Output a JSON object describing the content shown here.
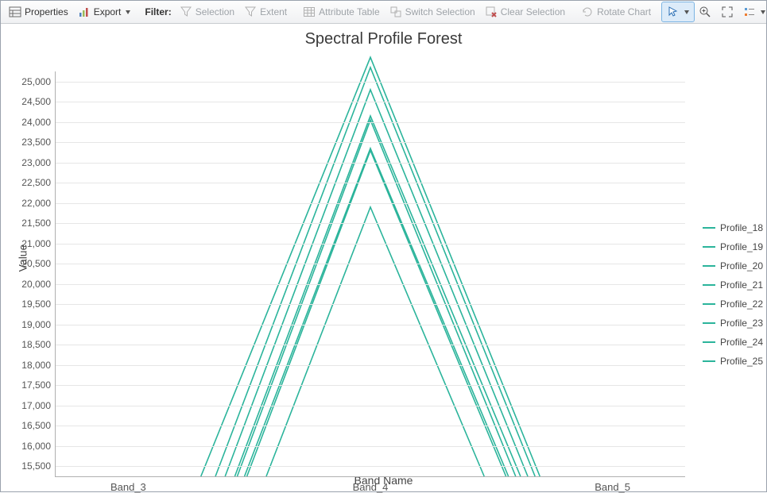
{
  "toolbar": {
    "properties": "Properties",
    "export": "Export",
    "filter_label": "Filter:",
    "selection": "Selection",
    "extent": "Extent",
    "attribute_table": "Attribute Table",
    "switch_selection": "Switch Selection",
    "clear_selection": "Clear Selection",
    "rotate_chart": "Rotate Chart"
  },
  "chart": {
    "title": "Spectral Profile Forest",
    "xlabel": "Band Name",
    "ylabel": "Value"
  },
  "chart_data": {
    "type": "line",
    "title": "Spectral Profile Forest",
    "xlabel": "Band Name",
    "ylabel": "Value",
    "ylim": [
      15250,
      25250
    ],
    "x_categories": [
      "Band_3",
      "Band_4",
      "Band_5"
    ],
    "y_ticks": [
      15500,
      16000,
      16500,
      17000,
      17500,
      18000,
      18500,
      19000,
      19500,
      20000,
      20500,
      21000,
      21500,
      22000,
      22500,
      23000,
      23500,
      24000,
      24500,
      25000
    ],
    "color": "#2bb49b",
    "series": [
      {
        "name": "Profile_18",
        "x": [
          3.3,
          4.0,
          4.7
        ],
        "y": [
          15250,
          25600,
          15250
        ]
      },
      {
        "name": "Profile_19",
        "x": [
          3.36,
          4.0,
          4.68
        ],
        "y": [
          15250,
          25350,
          15250
        ]
      },
      {
        "name": "Profile_20",
        "x": [
          3.4,
          4.0,
          4.65
        ],
        "y": [
          15250,
          24800,
          15250
        ]
      },
      {
        "name": "Profile_21",
        "x": [
          3.44,
          4.0,
          4.62
        ],
        "y": [
          15250,
          24150,
          15250
        ]
      },
      {
        "name": "Profile_22",
        "x": [
          3.45,
          4.0,
          4.6
        ],
        "y": [
          15250,
          24050,
          15250
        ]
      },
      {
        "name": "Profile_23",
        "x": [
          3.48,
          4.0,
          4.57
        ],
        "y": [
          15250,
          23350,
          15250
        ]
      },
      {
        "name": "Profile_24",
        "x": [
          3.49,
          4.0,
          4.56
        ],
        "y": [
          15250,
          23300,
          15250
        ]
      },
      {
        "name": "Profile_25",
        "x": [
          3.57,
          4.0,
          4.47
        ],
        "y": [
          15250,
          21900,
          15250
        ]
      }
    ]
  }
}
